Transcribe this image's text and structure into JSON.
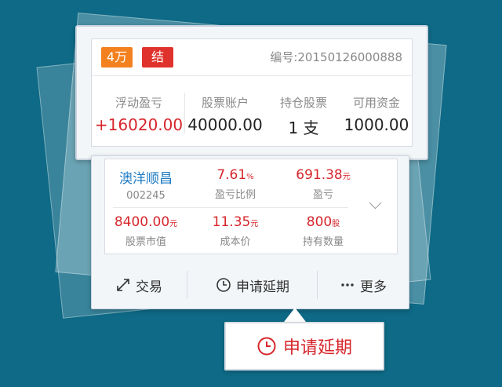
{
  "header": {
    "tag_amount": "4万",
    "tag_settle": "结",
    "order_label": "编号:",
    "order_value": "20150126000888"
  },
  "summary": [
    {
      "label": "浮动盈亏",
      "value": "+16020.00"
    },
    {
      "label": "股票账户",
      "value": "40000.00"
    },
    {
      "label": "持仓股票",
      "value": "1 支"
    },
    {
      "label": "可用资金",
      "value": "1000.00"
    }
  ],
  "position": {
    "stock_name": "澳洋顺昌",
    "stock_code": "002245",
    "profit_ratio": "7.61",
    "profit_ratio_unit": "%",
    "profit_ratio_label": "盈亏比例",
    "profit": "691.38",
    "profit_unit": "元",
    "profit_label": "盈亏",
    "market_value": "8400.00",
    "market_value_unit": "元",
    "market_value_label": "股票市值",
    "cost": "11.35",
    "cost_unit": "元",
    "cost_label": "成本价",
    "quantity": "800",
    "quantity_unit": "股",
    "quantity_label": "持有数量"
  },
  "actions": {
    "trade": "交易",
    "extend": "申请延期",
    "more": "更多"
  },
  "callout": {
    "label": "申请延期"
  },
  "colors": {
    "background": "#0e6a86",
    "red": "#d7262c",
    "orange": "#f3811f",
    "blue": "#1e7bc4"
  }
}
